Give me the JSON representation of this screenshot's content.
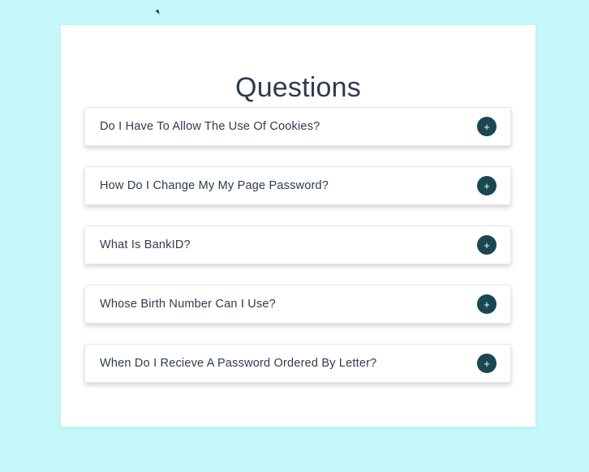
{
  "page": {
    "title": "Questions"
  },
  "colors": {
    "background": "#c4f8fb",
    "card": "#ffffff",
    "text": "#2f3b4c",
    "toggle": "#1b4753"
  },
  "faq": {
    "items": [
      {
        "question": "Do I Have To Allow The Use Of Cookies?",
        "icon": "plus-icon",
        "icon_glyph": "+"
      },
      {
        "question": "How Do I Change My My Page Password?",
        "icon": "plus-icon",
        "icon_glyph": "+"
      },
      {
        "question": "What Is BankID?",
        "icon": "plus-icon",
        "icon_glyph": "+"
      },
      {
        "question": "Whose Birth Number Can I Use?",
        "icon": "plus-icon",
        "icon_glyph": "+"
      },
      {
        "question": "When Do I Recieve A Password Ordered By Letter?",
        "icon": "plus-icon",
        "icon_glyph": "+"
      }
    ]
  }
}
